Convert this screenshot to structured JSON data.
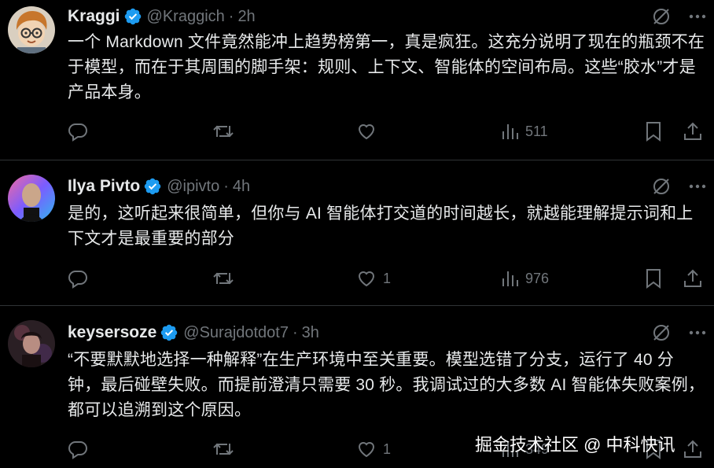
{
  "colors": {
    "background": "#000000",
    "text_primary": "#e7e9ea",
    "text_secondary": "#71767b",
    "verified_badge": "#1d9bf0",
    "divider": "#2f3336"
  },
  "tweets": [
    {
      "name": "Kraggi",
      "handle": "@Kraggich",
      "dot": "·",
      "time": "2h",
      "text": "一个 Markdown 文件竟然能冲上趋势榜第一，真是疯狂。这充分说明了现在的瓶颈不在于模型，而在于其周围的脚手架：规则、上下文、智能体的空间布局。这些“胶水”才是产品本身。",
      "replies": "",
      "reposts": "",
      "likes": "",
      "views": "511",
      "icons": [
        "grok-icon",
        "more-icon",
        "reply-icon",
        "repost-icon",
        "like-icon",
        "views-icon",
        "bookmark-icon",
        "share-icon"
      ]
    },
    {
      "name": "Ilya Pivto",
      "handle": "@ipivto",
      "dot": "·",
      "time": "4h",
      "text": "是的，这听起来很简单，但你与 AI 智能体打交道的时间越长，就越能理解提示词和上下文才是最重要的部分",
      "replies": "",
      "reposts": "",
      "likes": "1",
      "views": "976",
      "icons": [
        "grok-icon",
        "more-icon",
        "reply-icon",
        "repost-icon",
        "like-icon",
        "views-icon",
        "bookmark-icon",
        "share-icon"
      ]
    },
    {
      "name": "keysersoze",
      "handle": "@Surajdotdot7",
      "dot": "·",
      "time": "3h",
      "text": "“不要默默地选择一种解释”在生产环境中至关重要。模型选错了分支，运行了 40 分钟，最后碰壁失败。而提前澄清只需要 30 秒。我调试过的大多数 AI 智能体失败案例，都可以追溯到这个原因。",
      "replies": "",
      "reposts": "",
      "likes": "1",
      "views": "349",
      "icons": [
        "grok-icon",
        "more-icon",
        "reply-icon",
        "repost-icon",
        "like-icon",
        "views-icon",
        "bookmark-icon",
        "share-icon"
      ]
    }
  ],
  "watermark": "掘金技术社区 @ 中科快讯"
}
